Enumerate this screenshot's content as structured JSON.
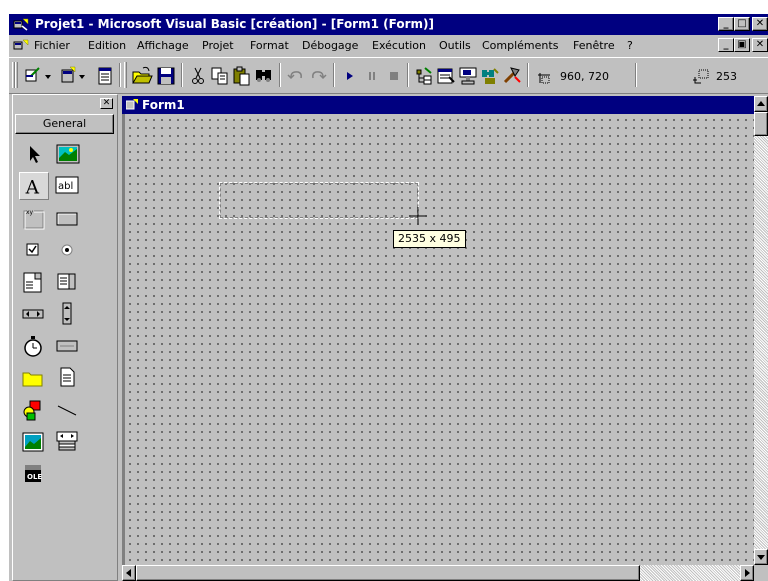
{
  "window": {
    "title": "Projet1 - Microsoft Visual Basic [création] - [Form1 (Form)]",
    "minimize": "_",
    "restore": "□",
    "close": "✕"
  },
  "menu": {
    "items": [
      "Fichier",
      "Edition",
      "Affichage",
      "Projet",
      "Format",
      "Débogage",
      "Exécution",
      "Outils",
      "Compléments",
      "Fenêtre",
      "?"
    ],
    "mdi_minimize": "_",
    "mdi_restore": "▣",
    "mdi_close": "✕"
  },
  "toolbar": {
    "form_position": "960, 720",
    "form_size": "253"
  },
  "toolbox": {
    "close": "✕",
    "tab_label": "General",
    "tools": [
      "pointer-icon",
      "picturebox-icon",
      "label-icon",
      "textbox-icon",
      "frame-icon",
      "commandbutton-icon",
      "checkbox-icon",
      "optionbutton-icon",
      "combobox-icon",
      "listbox-icon",
      "hscrollbar-icon",
      "vscrollbar-icon",
      "timer-icon",
      "drivelistbox-icon",
      "dirlistbox-icon",
      "filelistbox-icon",
      "shape-icon",
      "line-icon",
      "image-icon",
      "data-icon",
      "ole-icon"
    ]
  },
  "form": {
    "caption": "Form1",
    "size_tooltip": "2535 x 495"
  },
  "colors": {
    "title_bar": "#000080",
    "face": "#c0c0c0",
    "tooltip_bg": "#ffffe1"
  }
}
